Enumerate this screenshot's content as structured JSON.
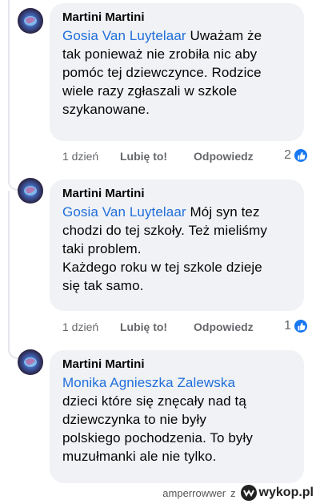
{
  "comments": [
    {
      "author": "Martini Martini",
      "mention": "Gosia Van Luytelaar",
      "lines": [
        " Uważam że",
        "tak ponieważ nie zrobiła nic aby",
        "pomóc tej dziewczynce. Rodzice",
        "wiele razy zgłaszali w szkole",
        "szykanowane."
      ],
      "time": "1 dzień",
      "like_label": "Lubię to!",
      "reply_label": "Odpowiedz",
      "reaction_count": "2"
    },
    {
      "author": "Martini Martini",
      "mention": "Gosia Van Luytelaar",
      "lines": [
        " Mój syn tez",
        "chodzi do tej szkoły. Też mieliśmy",
        "taki problem.",
        "Każdego roku w tej szkole dzieje",
        "się tak samo."
      ],
      "time": "1 dzień",
      "like_label": "Lubię to!",
      "reply_label": "Odpowiedz",
      "reaction_count": "1"
    },
    {
      "author": "Martini Martini",
      "mention": "Monika Agnieszka Zalewska",
      "lines": [
        "dzieci które się znęcały nad tą",
        "dziewczynka to nie były",
        "polskiego pochodzenia. To były",
        "muzułmanki ale nie tylko."
      ]
    }
  ],
  "footer": {
    "username": "amperrowwer",
    "separator": "z",
    "site": "wykop.pl"
  },
  "colors": {
    "mention": "#216fdb",
    "bubble": "#f0f2f5",
    "meta": "#65676b",
    "like_badge": "#1877f2"
  }
}
